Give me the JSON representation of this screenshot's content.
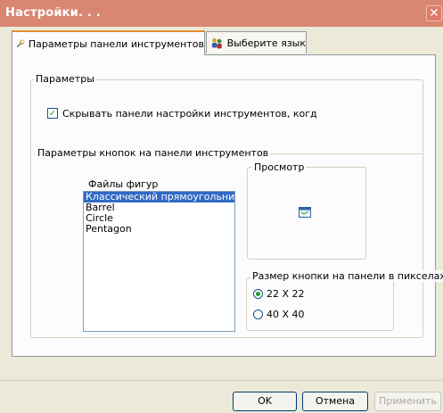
{
  "window": {
    "title": "Настройки. . .",
    "close_glyph": "✕"
  },
  "tabs": [
    {
      "label": "Параметры панели инструментов",
      "icon": "wrench-icon",
      "active": true
    },
    {
      "label": "Выберите язык",
      "icon": "people-icon",
      "active": false
    }
  ],
  "params_group": {
    "legend": "Параметры",
    "hide_toolbars_label": "Скрывать панели настройки инструментов, когд",
    "hide_toolbars_checked": true,
    "check_glyph": "✓"
  },
  "button_params_group": {
    "legend": "Параметры кнопок на панели инструментов",
    "shapes_label": "Файлы фигур",
    "shapes": [
      "Классический прямоугольник",
      "Barrel",
      "Circle",
      "Pentagon"
    ],
    "selected_shape": "Классический прямоугольник",
    "preview_legend": "Просмотр",
    "size_legend": "Размер кнопки на панели в пикселах",
    "size_options": [
      {
        "label": "22 X 22",
        "selected": true
      },
      {
        "label": "40 X 40",
        "selected": false
      }
    ]
  },
  "buttons": {
    "ok": "OK",
    "cancel": "Отмена",
    "apply": "Применить"
  },
  "colors": {
    "title_bar": "#d98672",
    "face": "#ece9d8",
    "selection": "#316ac5",
    "tab_accent": "#e68b2c"
  }
}
